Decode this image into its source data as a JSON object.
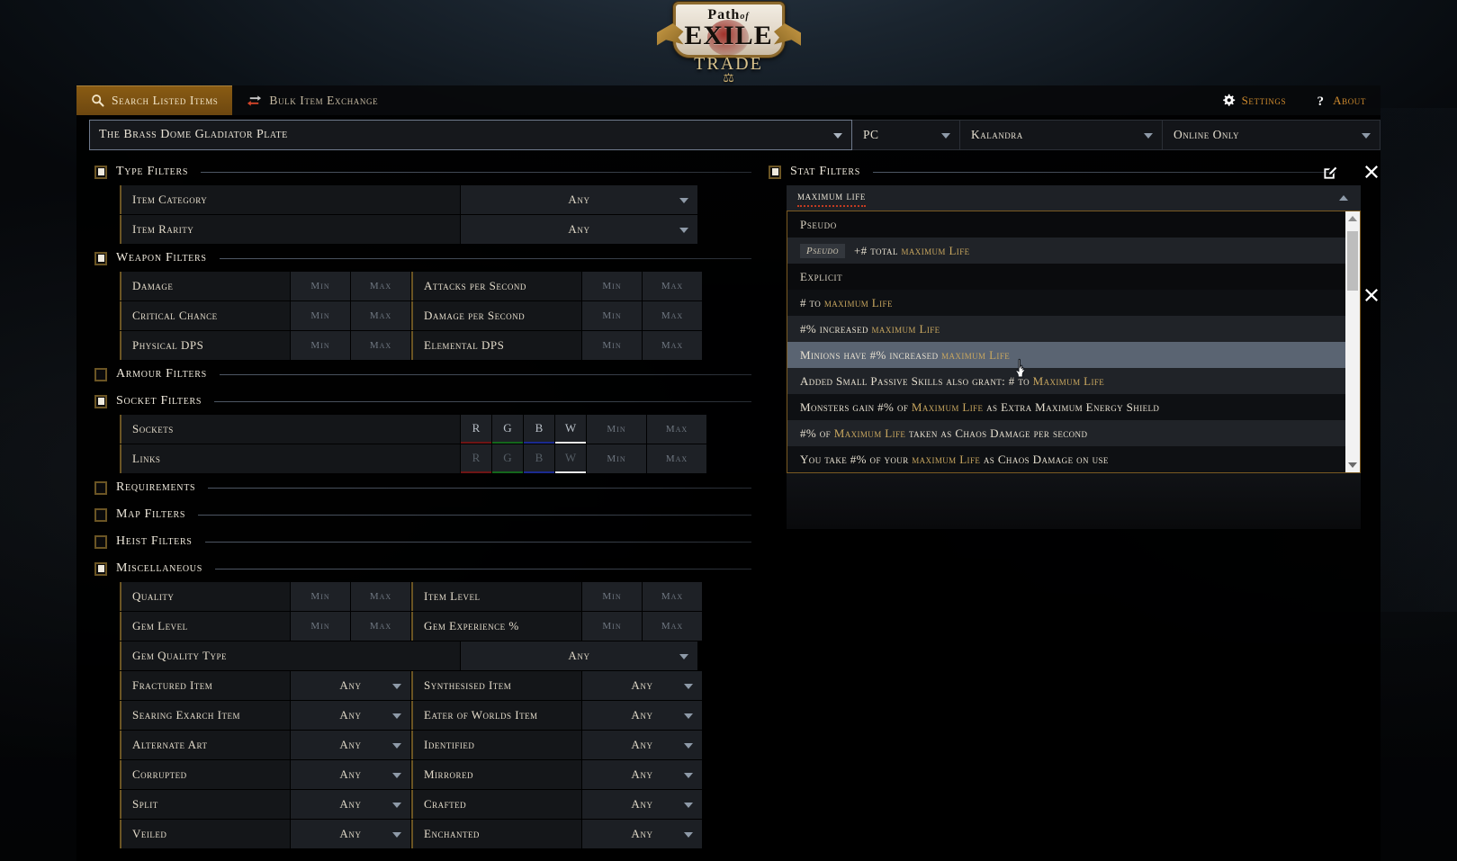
{
  "brand": {
    "line1": "Path",
    "line1_small": "of",
    "line2": "EXILE",
    "line3": "TRADE",
    "scale_glyph": "⚖"
  },
  "nav": {
    "tabs": [
      {
        "label": "Search Listed Items",
        "icon": "search-icon",
        "active": true
      },
      {
        "label": "Bulk Item Exchange",
        "icon": "exchange-icon",
        "active": false
      }
    ],
    "links": [
      {
        "label": "Settings",
        "icon": "gear-icon"
      },
      {
        "label": "About",
        "icon": "question-icon"
      }
    ]
  },
  "search": {
    "query": "The Brass Dome Gladiator Plate",
    "platform": "PC",
    "league": "Kalandra",
    "status": "Online Only"
  },
  "left_filters": [
    {
      "name": "Type Filters",
      "checked": true,
      "rows": [
        {
          "kind": "select",
          "label": "Item Category",
          "value": "Any"
        },
        {
          "kind": "select",
          "label": "Item Rarity",
          "value": "Any"
        }
      ]
    },
    {
      "name": "Weapon Filters",
      "checked": true,
      "rows": [
        {
          "kind": "minmax2",
          "label_a": "Damage",
          "label_b": "Attacks per Second",
          "min": "Min",
          "max": "Max"
        },
        {
          "kind": "minmax2",
          "label_a": "Critical Chance",
          "label_b": "Damage per Second",
          "min": "Min",
          "max": "Max"
        },
        {
          "kind": "minmax2",
          "label_a": "Physical DPS",
          "label_b": "Elemental DPS",
          "min": "Min",
          "max": "Max"
        }
      ]
    },
    {
      "name": "Armour Filters",
      "checked": false,
      "rows": []
    },
    {
      "name": "Socket Filters",
      "checked": true,
      "rows": [
        {
          "kind": "sockets",
          "label": "Sockets",
          "colors": [
            "R",
            "G",
            "B",
            "W"
          ],
          "min": "Min",
          "max": "Max",
          "dim": false
        },
        {
          "kind": "sockets",
          "label": "Links",
          "colors": [
            "R",
            "G",
            "B",
            "W"
          ],
          "min": "Min",
          "max": "Max",
          "dim": true
        }
      ]
    },
    {
      "name": "Requirements",
      "checked": false,
      "rows": []
    },
    {
      "name": "Map Filters",
      "checked": false,
      "rows": []
    },
    {
      "name": "Heist Filters",
      "checked": false,
      "rows": []
    },
    {
      "name": "Miscellaneous",
      "checked": true,
      "rows": [
        {
          "kind": "minmax2",
          "label_a": "Quality",
          "label_b": "Item Level",
          "min": "Min",
          "max": "Max"
        },
        {
          "kind": "minmax2",
          "label_a": "Gem Level",
          "label_b": "Gem Experience %",
          "min": "Min",
          "max": "Max"
        },
        {
          "kind": "select",
          "label": "Gem Quality Type",
          "value": "Any"
        },
        {
          "kind": "select2",
          "label_a": "Fractured Item",
          "value_a": "Any",
          "label_b": "Synthesised Item",
          "value_b": "Any"
        },
        {
          "kind": "select2",
          "label_a": "Searing Exarch Item",
          "value_a": "Any",
          "label_b": "Eater of Worlds Item",
          "value_b": "Any"
        },
        {
          "kind": "select2",
          "label_a": "Alternate Art",
          "value_a": "Any",
          "label_b": "Identified",
          "value_b": "Any"
        },
        {
          "kind": "select2",
          "label_a": "Corrupted",
          "value_a": "Any",
          "label_b": "Mirrored",
          "value_b": "Any"
        },
        {
          "kind": "select2",
          "label_a": "Split",
          "value_a": "Any",
          "label_b": "Crafted",
          "value_b": "Any"
        },
        {
          "kind": "select2",
          "label_a": "Veiled",
          "value_a": "Any",
          "label_b": "Enchanted",
          "value_b": "Any"
        }
      ]
    }
  ],
  "stat_filters": {
    "title": "Stat Filters",
    "checked": true,
    "edit_icon": "edit-icon",
    "close_icon": "close-icon",
    "search_value": "maximum life",
    "dropdown": [
      {
        "type": "section",
        "label": "Pseudo"
      },
      {
        "type": "option",
        "badge": "Pseudo",
        "parts": [
          {
            "t": "+# total ",
            "c": "plain"
          },
          {
            "t": "maximum Life",
            "c": "mod"
          }
        ]
      },
      {
        "type": "section",
        "label": "Explicit"
      },
      {
        "type": "option",
        "parts": [
          {
            "t": "# to ",
            "c": "plain"
          },
          {
            "t": "maximum Life",
            "c": "mod"
          }
        ]
      },
      {
        "type": "option",
        "parts": [
          {
            "t": "#% increased ",
            "c": "plain"
          },
          {
            "t": "maximum Life",
            "c": "mod"
          }
        ]
      },
      {
        "type": "option",
        "selected": true,
        "parts": [
          {
            "t": "Minions have #% increased ",
            "c": "plain"
          },
          {
            "t": "maximum Life",
            "c": "mod"
          }
        ]
      },
      {
        "type": "option",
        "parts": [
          {
            "t": "Added Small Passive Skills also grant: # to ",
            "c": "plain"
          },
          {
            "t": "Maximum Life",
            "c": "mod"
          }
        ]
      },
      {
        "type": "option",
        "parts": [
          {
            "t": "Monsters gain #% of ",
            "c": "plain"
          },
          {
            "t": "Maximum Life",
            "c": "mod"
          },
          {
            "t": " as Extra Maximum Energy Shield",
            "c": "plain"
          }
        ]
      },
      {
        "type": "option",
        "parts": [
          {
            "t": "#% of ",
            "c": "plain"
          },
          {
            "t": "Maximum Life",
            "c": "mod"
          },
          {
            "t": " taken as Chaos Damage per second",
            "c": "plain"
          }
        ]
      },
      {
        "type": "option",
        "parts": [
          {
            "t": "You take #% of your ",
            "c": "plain"
          },
          {
            "t": "maximum Life",
            "c": "mod"
          },
          {
            "t": " as Chaos Damage on use",
            "c": "plain"
          }
        ]
      }
    ]
  },
  "colors": {
    "accent_gold": "#8a5c13",
    "link_orange": "#cf8b2e",
    "mod_gold": "#c9a75f",
    "selected_row": "#5a6472",
    "panel_bg": "#1e2126",
    "socket_r": "#6e1515",
    "socket_g": "#14661c",
    "socket_b": "#1b2a8f",
    "socket_w": "#e8e8e8"
  }
}
